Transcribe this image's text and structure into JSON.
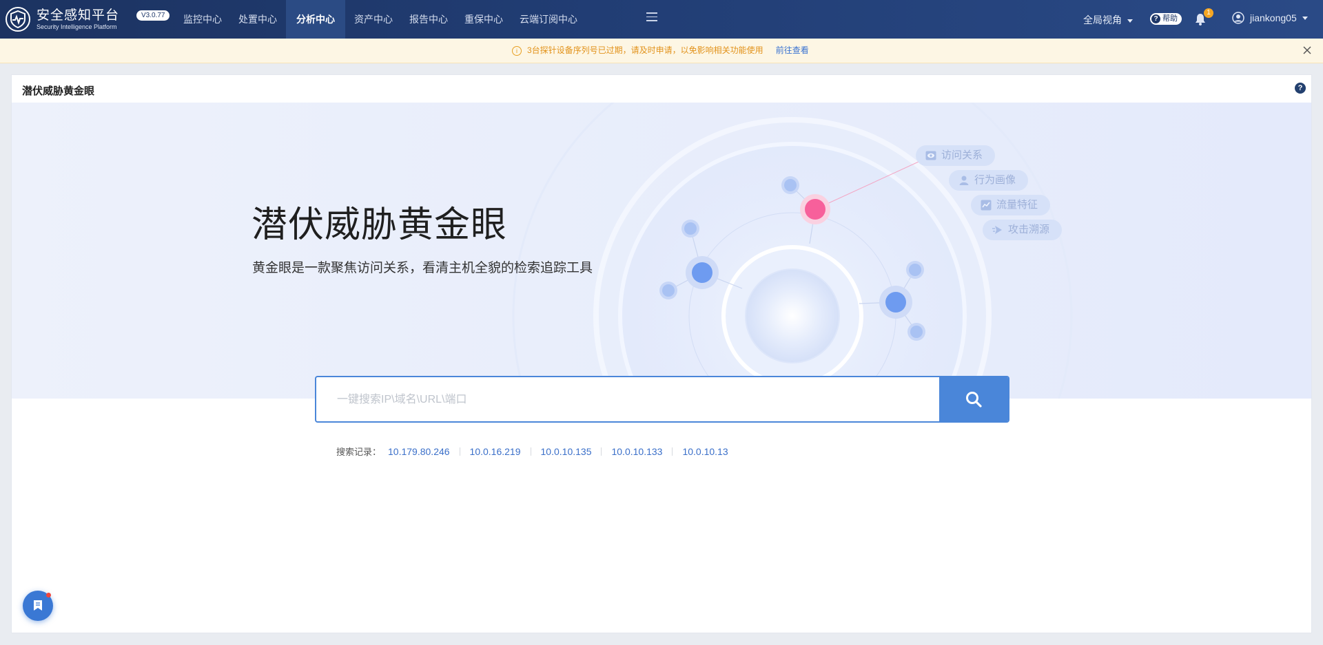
{
  "app": {
    "title": "安全感知平台",
    "subtitle": "Security Intelligence Platform",
    "version": "V3.0.77"
  },
  "nav": {
    "items": [
      "监控中心",
      "处置中心",
      "分析中心",
      "资产中心",
      "报告中心",
      "重保中心",
      "云端订阅中心"
    ],
    "active": "分析中心"
  },
  "header_right": {
    "view_switch": "全局视角",
    "help": "帮助",
    "notification_count": "1",
    "username": "jiankong05"
  },
  "notice": {
    "text": "3台探针设备序列号已过期，请及时申请，以免影响相关功能使用",
    "link": "前往查看"
  },
  "panel": {
    "title": "潜伏威胁黄金眼"
  },
  "hero": {
    "title": "潜伏威胁黄金眼",
    "subtitle": "黄金眼是一款聚焦访问关系，看清主机全貌的检索追踪工具",
    "tags": [
      "访问关系",
      "行为画像",
      "流量特征",
      "攻击溯源"
    ]
  },
  "search": {
    "placeholder": "一键搜索IP\\域名\\URL\\端口",
    "value": ""
  },
  "history": {
    "label": "搜索记录：",
    "items": [
      "10.179.80.246",
      "10.0.16.219",
      "10.0.10.135",
      "10.0.10.133",
      "10.0.10.13"
    ]
  },
  "colors": {
    "nav_bg": "#213d74",
    "accent": "#4a86d9",
    "notice_text": "#e2921a",
    "link": "#3a6fc9",
    "node_pink": "#f7609b"
  }
}
